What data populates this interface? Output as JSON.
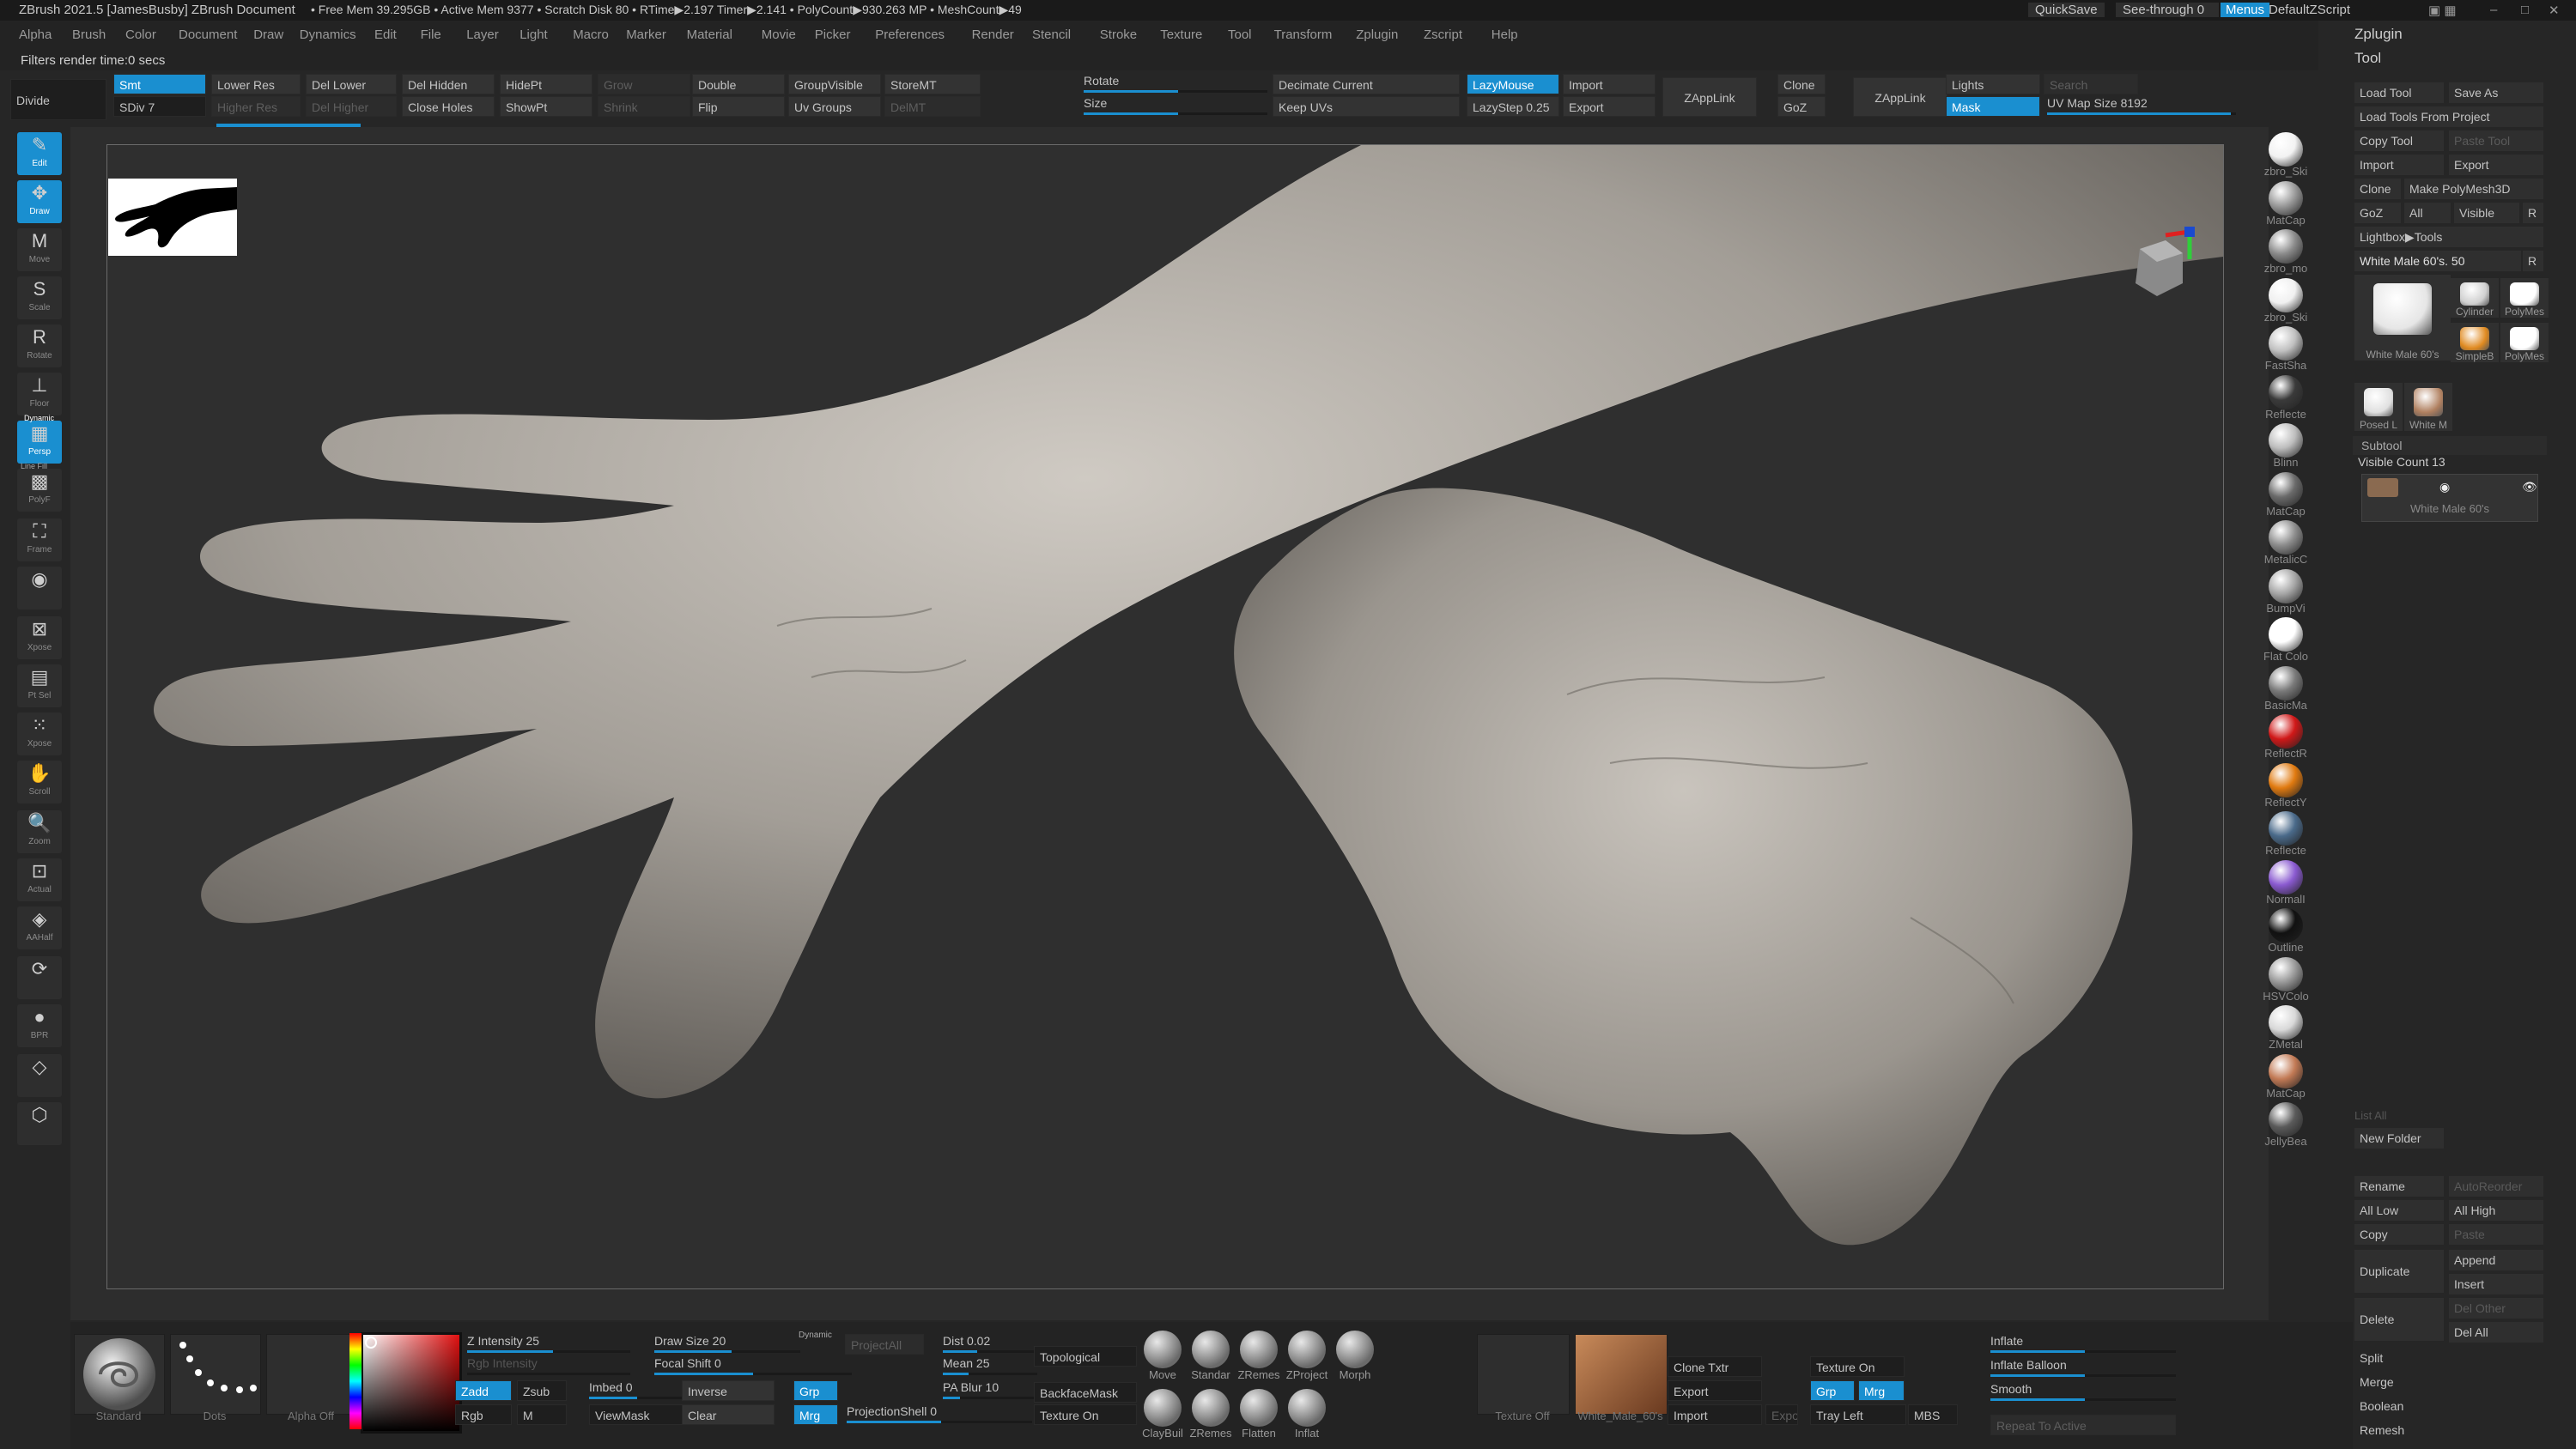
{
  "titlebar": {
    "app_title": "ZBrush 2021.5 [JamesBusby]   ZBrush Document",
    "stats": "• Free Mem 39.295GB • Active Mem 9377 • Scratch Disk 80 •  RTime▶2.197 Timer▶2.141 • PolyCount▶930.263 MP  • MeshCount▶49",
    "quicksave": "QuickSave",
    "see_through": "See-through  0",
    "menus": "Menus",
    "default_zscript": "DefaultZScript"
  },
  "menus": [
    "Alpha",
    "Brush",
    "Color",
    "Document",
    "Draw",
    "Dynamics",
    "Edit",
    "File",
    "Layer",
    "Light",
    "Macro",
    "Marker",
    "Material",
    "Movie",
    "Picker",
    "Preferences",
    "Render",
    "Stencil",
    "Stroke",
    "Texture",
    "Tool",
    "Transform",
    "Zplugin",
    "Zscript",
    "Help"
  ],
  "info": "Filters render time:0 secs",
  "toolbar": {
    "divide": "Divide",
    "smt": "Smt",
    "sdiv": "SDiv 7",
    "lower_res": "Lower Res",
    "higher_res": "Higher Res",
    "del_lower": "Del Lower",
    "del_higher": "Del Higher",
    "del_hidden": "Del Hidden",
    "close_holes": "Close Holes",
    "hidept": "HidePt",
    "showpt": "ShowPt",
    "grow": "Grow",
    "shrink": "Shrink",
    "double": "Double",
    "flip": "Flip",
    "group_visible": "GroupVisible",
    "uv_groups": "Uv Groups",
    "storemt": "StoreMT",
    "delmt": "DelMT",
    "rotate": "Rotate",
    "size": "Size",
    "decimate_current": "Decimate Current",
    "keep_uvs": "Keep UVs",
    "lazymouse": "LazyMouse",
    "lazystep": "LazyStep 0.25",
    "import": "Import",
    "export": "Export",
    "zapplink": "ZAppLink",
    "clone": "Clone",
    "goz": "GoZ",
    "zapplink2": "ZAppLink",
    "lights": "Lights",
    "search": "Search",
    "mask": "Mask",
    "uv_map_size": "UV Map Size 8192"
  },
  "left_tools": [
    {
      "label": "Edit",
      "icon": "✎"
    },
    {
      "label": "Draw",
      "icon": "✥"
    },
    {
      "label": "Move",
      "icon": "M"
    },
    {
      "label": "Scale",
      "icon": "S"
    },
    {
      "label": "Rotate",
      "icon": "R"
    },
    {
      "label": "Floor",
      "icon": "⊥"
    },
    {
      "label": "Persp",
      "icon": "▦"
    },
    {
      "label": "PolyF",
      "icon": "▩"
    },
    {
      "label": "Frame",
      "icon": "⛶"
    },
    {
      "label": "",
      "icon": "◉"
    },
    {
      "label": "Xpose",
      "icon": "⊠"
    },
    {
      "label": "Pt Sel",
      "icon": "▤"
    },
    {
      "label": "Xpose",
      "icon": "⁙"
    },
    {
      "label": "Scroll",
      "icon": "✋"
    },
    {
      "label": "Zoom",
      "icon": "🔍"
    },
    {
      "label": "Actual",
      "icon": "⊡"
    },
    {
      "label": "AAHalf",
      "icon": "◈"
    },
    {
      "label": "",
      "icon": "⟳"
    },
    {
      "label": "BPR",
      "icon": "●"
    },
    {
      "label": "",
      "icon": "◇"
    },
    {
      "label": "",
      "icon": "⬡"
    }
  ],
  "left_labels": {
    "dynamic": "Dynamic",
    "line_fill": "Line Fill"
  },
  "materials": [
    {
      "label": "zbro_Ski",
      "color": "#f2f2f2"
    },
    {
      "label": "MatCap",
      "color": "#9a9a9a"
    },
    {
      "label": "zbro_mo",
      "color": "#8a8a8a"
    },
    {
      "label": "zbro_Ski",
      "color": "#f0f0f0"
    },
    {
      "label": "FastSha",
      "color": "#c0c0c0"
    },
    {
      "label": "Reflecte",
      "color": "#3a3a3a"
    },
    {
      "label": "Blinn",
      "color": "#bdbdbd"
    },
    {
      "label": "MatCap",
      "color": "#6a6a6a"
    },
    {
      "label": "MetalicC",
      "color": "#8d8d8d"
    },
    {
      "label": "BumpVi",
      "color": "#a5a5a5"
    },
    {
      "label": "Flat Colo",
      "color": "#ffffff"
    },
    {
      "label": "BasicMa",
      "color": "#7a7a7a"
    },
    {
      "label": "ReflectR",
      "color": "#d01818"
    },
    {
      "label": "ReflectY",
      "color": "#e07a10"
    },
    {
      "label": "Reflecte",
      "color": "#4a6a8a"
    },
    {
      "label": "NormalI",
      "color": "#8a5ad0"
    },
    {
      "label": "Outline",
      "color": "#111111"
    },
    {
      "label": "HSVColo",
      "color": "#9a9a9a"
    },
    {
      "label": "ZMetal",
      "color": "#d8d8d8"
    },
    {
      "label": "MatCap",
      "color": "#c27a55"
    },
    {
      "label": "JellyBea",
      "color": "#5a5a5a"
    }
  ],
  "right": {
    "zplugin": "Zplugin",
    "tool": "Tool",
    "load_tool": "Load Tool",
    "save_as": "Save As",
    "load_from_project": "Load Tools From Project",
    "copy_tool": "Copy Tool",
    "paste_tool": "Paste Tool",
    "import": "Import",
    "export": "Export",
    "clone": "Clone",
    "make_polymesh": "Make PolyMesh3D",
    "goz": "GoZ",
    "all": "All",
    "visible": "Visible",
    "r": "R",
    "lightbox_tools": "Lightbox▶Tools",
    "current_tool": "White Male 60's. 50",
    "r2": "R",
    "tool_thumbs": [
      {
        "label": "White Male 60's"
      },
      {
        "label": "Cylinder"
      },
      {
        "label": "PolyMes"
      },
      {
        "label": "SimpleB"
      },
      {
        "label": "PolyMes"
      },
      {
        "label": "Posed L"
      },
      {
        "label": "White M"
      }
    ],
    "subtool": "Subtool",
    "visible_count": "Visible Count 13",
    "subtool_item": "White Male 60's",
    "list_all": "List All",
    "new_folder": "New Folder",
    "rename": "Rename",
    "autoreorder": "AutoReorder",
    "all_low": "All Low",
    "all_high": "All High",
    "copy": "Copy",
    "paste": "Paste",
    "duplicate": "Duplicate",
    "append": "Append",
    "insert": "Insert",
    "delete": "Delete",
    "del_other": "Del Other",
    "del_all": "Del All",
    "split": "Split",
    "merge": "Merge",
    "boolean": "Boolean",
    "remesh": "Remesh"
  },
  "bottom": {
    "standard": "Standard",
    "dots": "Dots",
    "alpha_off": "Alpha Off",
    "z_intensity": "Z Intensity 25",
    "rgb_intensity": "Rgb Intensity",
    "zadd": "Zadd",
    "zsub": "Zsub",
    "rgb": "Rgb",
    "m": "M",
    "draw_size": "Draw Size 20",
    "dynamic": "Dynamic",
    "focal_shift": "Focal Shift 0",
    "imbed": "Imbed 0",
    "viewmask": "ViewMask",
    "inverse": "Inverse",
    "clear": "Clear",
    "grp": "Grp",
    "mrg": "Mrg",
    "projectall": "ProjectAll",
    "dist": "Dist 0.02",
    "mean": "Mean 25",
    "pa_blur": "PA Blur 10",
    "projection_shell": "ProjectionShell 0",
    "topological": "Topological",
    "backfacemask": "BackfaceMask",
    "texture_on": "Texture On",
    "brushes": [
      {
        "label": "Move"
      },
      {
        "label": "Standar"
      },
      {
        "label": "ZRemes"
      },
      {
        "label": "ZProject"
      },
      {
        "label": "Morph"
      },
      {
        "label": "ClayBuil"
      },
      {
        "label": "ZRemes"
      },
      {
        "label": "Flatten"
      },
      {
        "label": "Inflat"
      }
    ],
    "texture_off": "Texture Off",
    "tex_name": "White_Male_60's",
    "clone_txtr": "Clone Txtr",
    "export": "Export",
    "import": "Import",
    "export2": "Export",
    "texture_on2": "Texture On",
    "grp2": "Grp",
    "mrg2": "Mrg",
    "tray_left": "Tray Left",
    "mbs": "MBS",
    "inflate": "Inflate",
    "inflate_balloon": "Inflate Balloon",
    "smooth": "Smooth",
    "repeat_to_active": "Repeat To Active"
  }
}
